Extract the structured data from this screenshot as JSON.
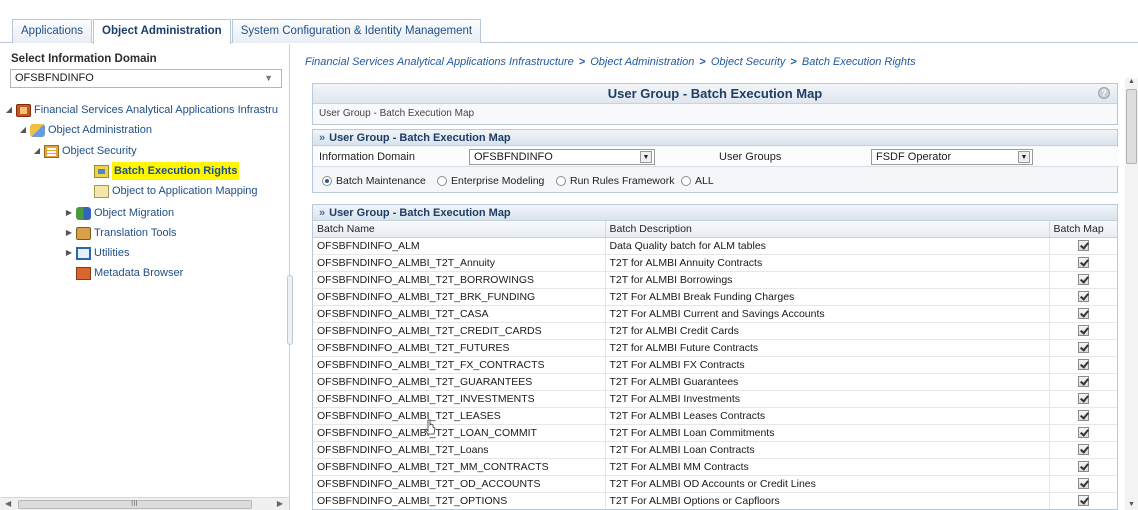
{
  "tabs": [
    "Applications",
    "Object Administration",
    "System Configuration & Identity Management"
  ],
  "left_panel": {
    "title": "Select Information Domain",
    "domain_value": "OFSBFNDINFO",
    "tree": {
      "root": "Financial Services Analytical Applications Infrastru",
      "object_administration": "Object Administration",
      "object_security": "Object Security",
      "batch_execution_rights": "Batch Execution Rights",
      "object_to_application_mapping": "Object to Application Mapping",
      "object_migration": "Object Migration",
      "translation_tools": "Translation Tools",
      "utilities": "Utilities",
      "metadata_browser": "Metadata Browser"
    },
    "scroll_grip": "III"
  },
  "breadcrumb": {
    "items": [
      "Financial Services Analytical Applications Infrastructure",
      "Object Administration",
      "Object Security",
      "Batch Execution Rights"
    ],
    "separator": ">"
  },
  "main_panel": {
    "title": "User Group - Batch Execution Map",
    "subtitle": "User Group - Batch Execution Map",
    "help": "?"
  },
  "form_section": {
    "header": "User Group - Batch Execution Map",
    "info_domain_label": "Information Domain",
    "info_domain_value": "OFSBFNDINFO",
    "user_groups_label": "User Groups",
    "user_groups_value": "FSDF Operator",
    "radios": [
      "Batch Maintenance",
      "Enterprise Modeling",
      "Run Rules Framework",
      "ALL"
    ],
    "radio_selected": 0
  },
  "table_section": {
    "header": "User Group - Batch Execution Map",
    "columns": [
      "Batch Name",
      "Batch Description",
      "Batch Map"
    ],
    "rows": [
      {
        "name": "OFSBFNDINFO_ALM",
        "desc": "Data Quality batch for ALM tables",
        "checked": true
      },
      {
        "name": "OFSBFNDINFO_ALMBI_T2T_Annuity",
        "desc": "T2T for ALMBI Annuity Contracts",
        "checked": true
      },
      {
        "name": "OFSBFNDINFO_ALMBI_T2T_BORROWINGS",
        "desc": "T2T for ALMBI Borrowings",
        "checked": true
      },
      {
        "name": "OFSBFNDINFO_ALMBI_T2T_BRK_FUNDING",
        "desc": "T2T For ALMBI Break Funding Charges",
        "checked": true
      },
      {
        "name": "OFSBFNDINFO_ALMBI_T2T_CASA",
        "desc": "T2T For ALMBI Current and Savings Accounts",
        "checked": true
      },
      {
        "name": "OFSBFNDINFO_ALMBI_T2T_CREDIT_CARDS",
        "desc": "T2T for ALMBI Credit Cards",
        "checked": true
      },
      {
        "name": "OFSBFNDINFO_ALMBI_T2T_FUTURES",
        "desc": "T2T for ALMBI Future Contracts",
        "checked": true
      },
      {
        "name": "OFSBFNDINFO_ALMBI_T2T_FX_CONTRACTS",
        "desc": "T2T For ALMBI FX Contracts",
        "checked": true
      },
      {
        "name": "OFSBFNDINFO_ALMBI_T2T_GUARANTEES",
        "desc": "T2T For ALMBI Guarantees",
        "checked": true
      },
      {
        "name": "OFSBFNDINFO_ALMBI_T2T_INVESTMENTS",
        "desc": "T2T For ALMBI Investments",
        "checked": true
      },
      {
        "name": "OFSBFNDINFO_ALMBI_T2T_LEASES",
        "desc": "T2T For ALMBI Leases Contracts",
        "checked": true
      },
      {
        "name": "OFSBFNDINFO_ALMBI_T2T_LOAN_COMMIT",
        "desc": "T2T For ALMBI Loan Commitments",
        "checked": true
      },
      {
        "name": "OFSBFNDINFO_ALMBI_T2T_Loans",
        "desc": "T2T For ALMBI Loan Contracts",
        "checked": true
      },
      {
        "name": "OFSBFNDINFO_ALMBI_T2T_MM_CONTRACTS",
        "desc": "T2T For ALMBI MM Contracts",
        "checked": true
      },
      {
        "name": "OFSBFNDINFO_ALMBI_T2T_OD_ACCOUNTS",
        "desc": "T2T For ALMBI OD Accounts or Credit Lines",
        "checked": true
      },
      {
        "name": "OFSBFNDINFO_ALMBI_T2T_OPTIONS",
        "desc": "T2T For ALMBI Options or Capfloors",
        "checked": true
      }
    ]
  }
}
